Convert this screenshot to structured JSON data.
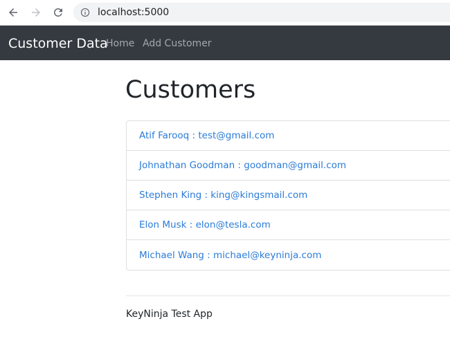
{
  "browser": {
    "url": "localhost:5000",
    "icons": [
      "back-arrow-icon",
      "forward-arrow-icon",
      "reload-icon",
      "info-icon"
    ]
  },
  "navbar": {
    "brand": "Customer Data",
    "links": [
      {
        "label": "Home"
      },
      {
        "label": "Add Customer"
      }
    ],
    "colors": {
      "background": "#343a40"
    }
  },
  "main": {
    "title": "Customers",
    "customers": [
      {
        "name": "Atif Farooq",
        "email": "test@gmail.com",
        "text": "Atif Farooq : test@gmail.com"
      },
      {
        "name": "Johnathan Goodman",
        "email": "goodman@gmail.com",
        "text": "Johnathan Goodman : goodman@gmail.com"
      },
      {
        "name": "Stephen King",
        "email": "king@kingsmail.com",
        "text": "Stephen King : king@kingsmail.com"
      },
      {
        "name": "Elon Musk",
        "email": "elon@tesla.com",
        "text": "Elon Musk : elon@tesla.com"
      },
      {
        "name": "Michael Wang",
        "email": "michael@keyninja.com",
        "text": "Michael Wang : michael@keyninja.com"
      }
    ],
    "link_color": "#2a7bd8"
  },
  "footer": {
    "text": "KeyNinja Test App"
  }
}
